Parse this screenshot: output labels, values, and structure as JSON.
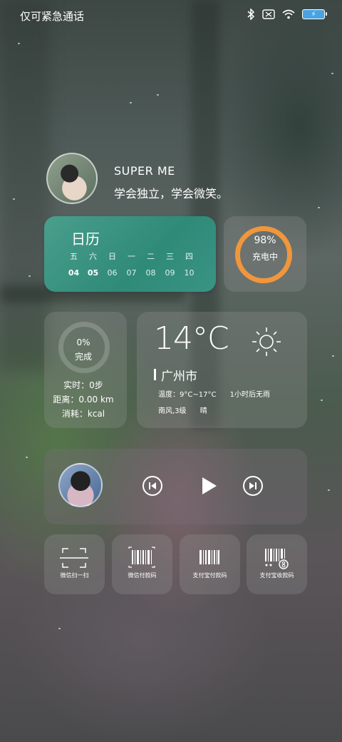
{
  "status_bar": {
    "carrier": "仅可紧急通话",
    "icons": [
      "bluetooth-icon",
      "sim-blocked-icon",
      "wifi-icon",
      "battery-charging-icon"
    ]
  },
  "profile": {
    "name": "SUPER ME",
    "motto": "学会独立，学会微笑。"
  },
  "calendar": {
    "title": "日历",
    "weekdays": [
      "五",
      "六",
      "日",
      "一",
      "二",
      "三",
      "四"
    ],
    "dates": [
      "04",
      "05",
      "06",
      "07",
      "08",
      "09",
      "10"
    ]
  },
  "charging": {
    "percent": "98%",
    "label": "充电中",
    "ring_color": "#f0963c"
  },
  "steps": {
    "percent": "0%",
    "label": "完成",
    "realtime": "实时：0步",
    "distance": "距离：0.00 km",
    "calories": "消耗：kcal"
  },
  "weather": {
    "temperature": "14°C",
    "city": "广州市",
    "range": "温度：9°C~17°C",
    "forecast": "1小时后无雨",
    "wind": "南风,3级",
    "condition": "晴",
    "icon": "sun-icon"
  },
  "music": {
    "prev_icon": "skip-previous-icon",
    "play_icon": "play-icon",
    "next_icon": "skip-next-icon"
  },
  "shortcuts": [
    {
      "label": "微信扫一扫",
      "icon": "scan-icon"
    },
    {
      "label": "微信付款码",
      "icon": "barcode-icon"
    },
    {
      "label": "支付宝付款码",
      "icon": "barcode-icon"
    },
    {
      "label": "支付宝收款码",
      "icon": "barcode-receive-icon"
    }
  ]
}
